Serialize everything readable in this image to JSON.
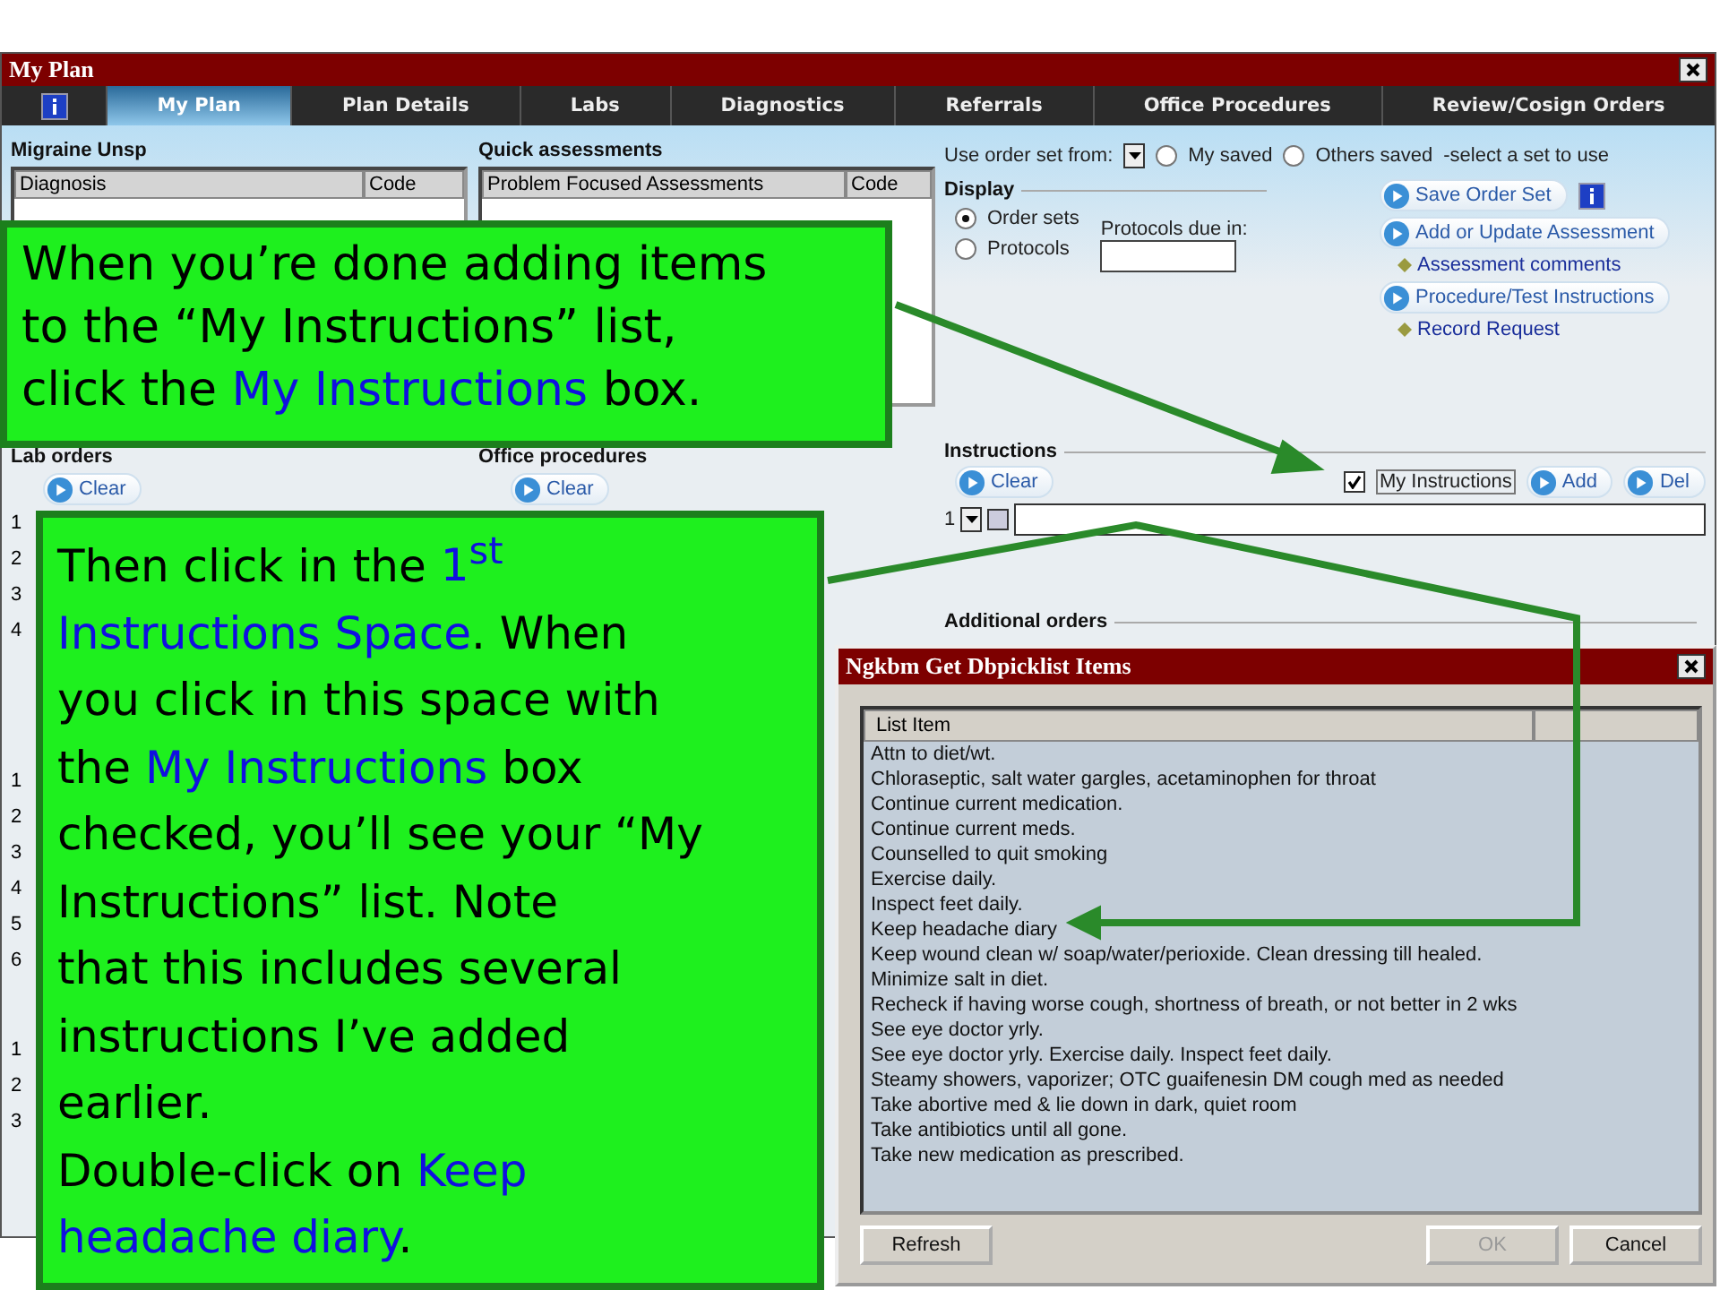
{
  "window": {
    "title": "My Plan"
  },
  "tabs": [
    {
      "label": "My Plan",
      "selected": true
    },
    {
      "label": "Plan Details",
      "selected": false
    },
    {
      "label": "Labs",
      "selected": false
    },
    {
      "label": "Diagnostics",
      "selected": false
    },
    {
      "label": "Referrals",
      "selected": false
    },
    {
      "label": "Office Procedures",
      "selected": false
    },
    {
      "label": "Review/Cosign Orders",
      "selected": false
    }
  ],
  "assessment_panel": {
    "heading": "Migraine Unsp",
    "columns": [
      "Diagnosis",
      "Code"
    ]
  },
  "quick_assessments": {
    "heading": "Quick assessments",
    "columns": [
      "Problem Focused Assessments",
      "Code"
    ]
  },
  "lab_orders": {
    "heading": "Lab orders",
    "clear": "Clear",
    "rows": [
      "1",
      "2",
      "3",
      "4"
    ]
  },
  "office_procedures": {
    "heading": "Office procedures",
    "clear": "Clear"
  },
  "section_3": {
    "rows": [
      "1",
      "2",
      "3",
      "4",
      "5",
      "6"
    ]
  },
  "section_4": {
    "rows": [
      "1",
      "2",
      "3"
    ]
  },
  "order_set": {
    "label": "Use order set from:",
    "options": [
      {
        "label": "My saved",
        "selected": false
      },
      {
        "label": "Others saved",
        "selected": false
      }
    ],
    "hint": "-select a set to use"
  },
  "display": {
    "heading": "Display",
    "options": [
      {
        "label": "Order sets",
        "selected": true
      },
      {
        "label": "Protocols",
        "selected": false
      }
    ],
    "protocols_label": "Protocols due in:"
  },
  "actions": [
    {
      "kind": "button",
      "label": "Save Order Set"
    },
    {
      "kind": "button",
      "label": "Add or Update Assessment"
    },
    {
      "kind": "link",
      "label": "Assessment comments"
    },
    {
      "kind": "button",
      "label": "Procedure/Test Instructions"
    },
    {
      "kind": "link",
      "label": "Record Request"
    }
  ],
  "instructions": {
    "heading": "Instructions",
    "clear": "Clear",
    "my_instructions": {
      "label": "My Instructions",
      "checked": true
    },
    "buttons": [
      "Add",
      "Del"
    ],
    "row": "1",
    "row_checked": false
  },
  "additional_orders": {
    "heading": "Additional orders"
  },
  "dialog": {
    "title": "Ngkbm Get Dbpicklist Items",
    "column": "List Item",
    "items": [
      "Attn to diet/wt.",
      "Chloraseptic, salt water gargles, acetaminophen for throat",
      "Continue current medication.",
      "Continue current meds.",
      "Counselled to quit smoking",
      "Exercise daily.",
      "Inspect feet daily.",
      "Keep headache diary",
      "Keep wound clean w/ soap/water/perioxide. Clean dressing till healed.",
      "Minimize salt in diet.",
      "Recheck if having worse cough, shortness of breath, or not better in 2 wks",
      "See eye doctor yrly.",
      "See eye doctor yrly. Exercise daily. Inspect feet daily.",
      "Steamy showers, vaporizer; OTC guaifenesin DM cough med as needed",
      "Take abortive med & lie down in dark, quiet room",
      "Take antibiotics until all gone.",
      "Take new medication as prescribed."
    ],
    "buttons": [
      {
        "label": "Refresh",
        "disabled": false
      },
      {
        "label": "OK",
        "disabled": true
      },
      {
        "label": "Cancel",
        "disabled": false
      }
    ]
  },
  "callouts": [
    {
      "paragraphs": [
        [
          [
            {
              "text": "When you’re done adding items",
              "kind": "plain"
            }
          ],
          [
            {
              "text": "to the “My Instructions” list,",
              "kind": "plain"
            }
          ],
          [
            {
              "text": "click the ",
              "kind": "plain"
            },
            {
              "text": "My Instructions",
              "kind": "highlight"
            },
            {
              "text": " box.",
              "kind": "plain"
            }
          ]
        ]
      ]
    },
    {
      "paragraphs": [
        [
          [
            {
              "text": "Then click in the ",
              "kind": "plain"
            },
            {
              "text": "1$^{st}$",
              "kind": "highlight"
            }
          ],
          [
            {
              "text": "Instructions Space",
              "kind": "highlight"
            },
            {
              "text": ".  When",
              "kind": "plain"
            }
          ],
          [
            {
              "text": "you click in this space with",
              "kind": "plain"
            }
          ],
          [
            {
              "text": "the ",
              "kind": "plain"
            },
            {
              "text": "My Instructions",
              "kind": "highlight"
            },
            {
              "text": " box",
              "kind": "plain"
            }
          ],
          [
            {
              "text": "checked, you’ll see your “My",
              "kind": "plain"
            }
          ],
          [
            {
              "text": "Instructions” list.  Note",
              "kind": "plain"
            }
          ],
          [
            {
              "text": "that this includes several",
              "kind": "plain"
            }
          ],
          [
            {
              "text": "instructions I’ve added",
              "kind": "plain"
            }
          ],
          [
            {
              "text": "earlier.",
              "kind": "plain"
            }
          ]
        ],
        [
          [
            {
              "text": "Double-click on ",
              "kind": "plain"
            },
            {
              "text": "Keep",
              "kind": "highlight"
            }
          ],
          [
            {
              "text": "headache diary",
              "kind": "highlight"
            },
            {
              "text": ".",
              "kind": "plain"
            }
          ]
        ]
      ]
    }
  ]
}
